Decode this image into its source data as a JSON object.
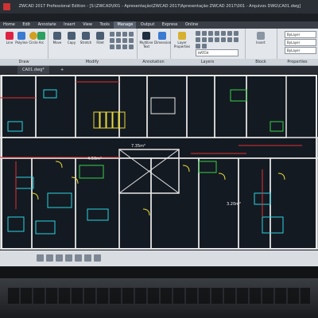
{
  "window": {
    "title": "ZWCAD 2017 Professional Edition - [S:\\ZWCAD\\001 - Apresentação\\ZWCAD 2017\\Apresentação ZWCAD 2017\\001 - Arquivos DWG\\CA01.dwg]"
  },
  "menu": {
    "items": [
      "Home",
      "Edit",
      "Annotate",
      "Insert",
      "View",
      "Tools",
      "Manage",
      "Output",
      "Express",
      "Online"
    ],
    "active_index": 6
  },
  "ribbon": {
    "draw": {
      "label": "Draw",
      "tools": [
        "Line",
        "Polyline",
        "Circle",
        "Arc"
      ]
    },
    "modify": {
      "label": "Modify",
      "tools": [
        "Move",
        "Copy",
        "Stretch",
        "Fillet"
      ]
    },
    "annotation": {
      "label": "Annotation",
      "tools": [
        "Multiline Text",
        "Dimension"
      ]
    },
    "layers": {
      "label": "Layers",
      "tools": [
        "Layer Properties"
      ],
      "hatch_value": "HATCH"
    },
    "block": {
      "label": "Block",
      "tools": [
        "Insert"
      ]
    },
    "properties": {
      "label": "Properties",
      "bylayer_1": "ByLayer",
      "bylayer_2": "ByLayer",
      "bylayer_3": "ByLayer"
    }
  },
  "doc_tab": {
    "label": "CA01.dwg*",
    "add_label": "+"
  },
  "drawing": {
    "background": "#141a22",
    "colors": {
      "walls": "#e8e8e8",
      "red": "#e03030",
      "yellow": "#e8d838",
      "cyan": "#2ad4e0",
      "green": "#38d048",
      "white": "#f2f2f2"
    },
    "labels": [
      "7.35m²",
      "4.50m²",
      "3.20m²"
    ]
  }
}
